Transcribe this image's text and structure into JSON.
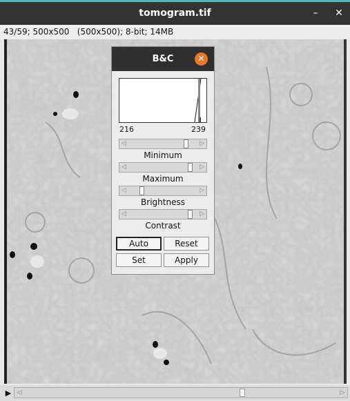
{
  "window": {
    "title": "tomogram.tif",
    "minimize_glyph": "–",
    "close_glyph": "✕",
    "accent_color": "#4fb8c3",
    "titlebar_color": "#333333"
  },
  "image_info": "43/59; 500x500   (500x500); 8-bit; 14MB",
  "stack_scrollbar": {
    "play_icon": "▶",
    "left_arrow": "◁",
    "right_arrow": "▷",
    "position_fraction": 0.7
  },
  "bc_dialog": {
    "title": "B&C",
    "close_glyph": "✕",
    "close_color": "#e8772e",
    "histogram": {
      "min_label": "216",
      "max_label": "239"
    },
    "sliders": [
      {
        "label": "Minimum",
        "value_fraction": 0.86
      },
      {
        "label": "Maximum",
        "value_fraction": 0.93
      },
      {
        "label": "Brightness",
        "value_fraction": 0.17
      },
      {
        "label": "Contrast",
        "value_fraction": 0.93
      }
    ],
    "buttons": {
      "auto": "Auto",
      "reset": "Reset",
      "set": "Set",
      "apply": "Apply"
    }
  }
}
